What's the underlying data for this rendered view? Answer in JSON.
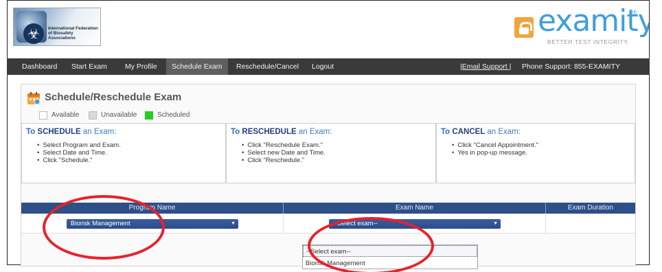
{
  "header": {
    "org_logo_text": "International Federation of Biosafety Associations",
    "brand_name": "examity",
    "brand_reg": "®",
    "brand_tagline": "BETTER TEST INTEGRITY."
  },
  "nav": {
    "items": [
      "Dashboard",
      "Start Exam",
      "My Profile",
      "Schedule Exam",
      "Reschedule/Cancel",
      "Logout"
    ],
    "active": "Schedule Exam",
    "email_support": "|Email Support |",
    "phone_support": "Phone Support: 855-EXAMITY"
  },
  "page": {
    "title": "Schedule/Reschedule Exam",
    "legend": [
      {
        "label": "Available",
        "color": "#ffffff"
      },
      {
        "label": "Unavailable",
        "color": "#d9d9d9"
      },
      {
        "label": "Scheduled",
        "color": "#22d022"
      }
    ]
  },
  "instructions": [
    {
      "prefix": "To",
      "verb": "SCHEDULE",
      "rest": "an Exam:",
      "steps": [
        "Select Program and Exam.",
        "Select Date and Time.",
        "Click \"Schedule.\""
      ]
    },
    {
      "prefix": "To",
      "verb": "RESCHEDULE",
      "rest": "an Exam:",
      "steps": [
        "Click \"Reschedule Exam.\"",
        "Select new Date and Time.",
        "Click \"Reschedule.\""
      ]
    },
    {
      "prefix": "To",
      "verb": "CANCEL",
      "rest": "an Exam:",
      "steps": [
        "Click \"Cancel Appointment.\"",
        "Yes in pop-up message."
      ]
    }
  ],
  "table": {
    "headers": [
      "Program Name",
      "Exam Name",
      "Exam Duration"
    ],
    "program_value": "Biorisk Management",
    "exam_value": "--Select exam--",
    "exam_options": [
      "--Select exam--",
      "Biorisk Management"
    ]
  },
  "colors": {
    "nav_bg": "#3a3a3a",
    "table_header": "#2f4f88",
    "accent_blue": "#2b6cb6",
    "brand_blue": "#3f9fd8",
    "brand_orange": "#f2a43a",
    "highlight_red": "#e8212a"
  }
}
